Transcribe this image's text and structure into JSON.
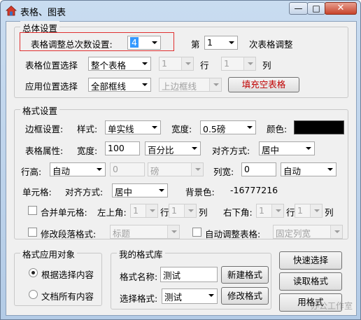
{
  "window": {
    "title": "表格、图表"
  },
  "overall": {
    "legend": "总体设置",
    "adjust_count_label": "表格调整总次数设置:",
    "adjust_count_value": "4",
    "nth_prefix": "第",
    "nth_value": "1",
    "nth_suffix": "次表格调整",
    "position_label": "表格位置选择",
    "position_value": "整个表格",
    "row_value": "1",
    "row_label": "行",
    "col_value": "1",
    "col_label": "列",
    "apply_label": "应用位置选择",
    "apply_value": "全部框线",
    "border_pos_value": "上边框线",
    "fill_button": "填充空表格",
    "fill_button_color": "#c00000",
    "highlight_color": "#e03030"
  },
  "format": {
    "legend": "格式设置",
    "border_label": "边框设置:",
    "style_label": "样式:",
    "style_value": "单实线",
    "width_label": "宽度:",
    "width_value": "0.5磅",
    "color_label": "颜色:",
    "color_swatch": "#000000",
    "table_attr_label": "表格属性:",
    "table_width_label": "宽度:",
    "table_width_value": "100",
    "table_width_unit": "百分比",
    "align_label": "对齐方式:",
    "align_value": "居中",
    "row_height_label": "行高:",
    "row_height_mode": "自动",
    "row_height_value": "0",
    "row_height_unit": "磅",
    "col_width_label": "列宽:",
    "col_width_value": "0",
    "col_width_mode": "自动",
    "cell_label": "单元格:",
    "cell_align_label": "对齐方式:",
    "cell_align_value": "居中",
    "bg_label": "背景色:",
    "bg_value": "-16777216",
    "merge_label": "合并单元格:",
    "top_left_label": "左上角:",
    "tl_row": "1",
    "tl_row_label": "行",
    "tl_col": "1",
    "tl_col_label": "列",
    "bottom_right_label": "右下角:",
    "br_row": "1",
    "br_row_label": "行",
    "br_col": "1",
    "br_col_label": "列",
    "para_label": "修改段落格式:",
    "para_value": "标题",
    "autofit_label": "自动调整表格:",
    "autofit_value": "固定列宽"
  },
  "apply_target": {
    "legend": "格式应用对象",
    "option_selected": "根据选择内容",
    "option_all": "文档所有内容"
  },
  "library": {
    "legend": "我的格式库",
    "name_label": "格式名称:",
    "name_value": "测试",
    "new_button": "新建格式",
    "select_label": "选择格式:",
    "select_value": "测试",
    "modify_button": "修改格式"
  },
  "actions": {
    "quick_select": "快速选择",
    "read_format": "读取格式",
    "apply_format": "用格式"
  },
  "watermark": {
    "text": "办公工作室"
  }
}
